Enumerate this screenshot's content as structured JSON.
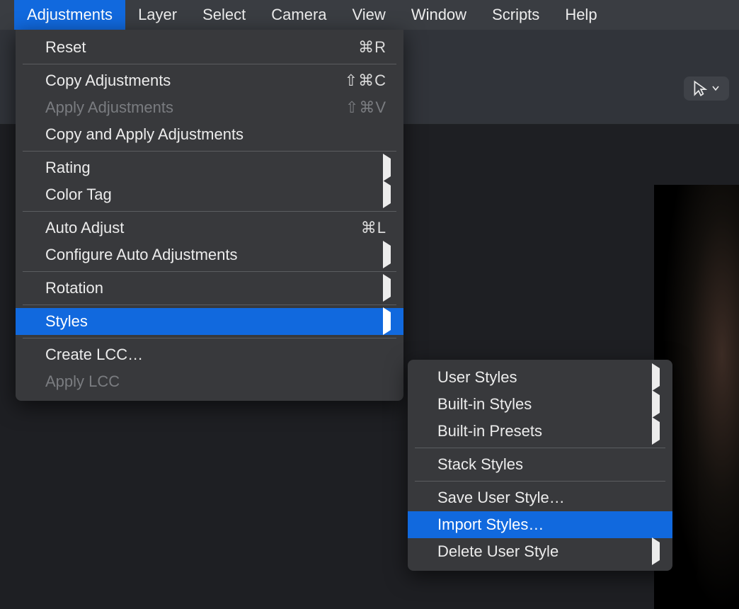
{
  "menubar": {
    "items": [
      {
        "label": "Adjustments",
        "active": true
      },
      {
        "label": "Layer"
      },
      {
        "label": "Select"
      },
      {
        "label": "Camera"
      },
      {
        "label": "View"
      },
      {
        "label": "Window"
      },
      {
        "label": "Scripts"
      },
      {
        "label": "Help"
      }
    ]
  },
  "menu": {
    "groups": [
      [
        {
          "label": "Reset",
          "shortcut": "⌘R"
        }
      ],
      [
        {
          "label": "Copy Adjustments",
          "shortcut": "⇧⌘C"
        },
        {
          "label": "Apply Adjustments",
          "shortcut": "⇧⌘V",
          "disabled": true
        },
        {
          "label": "Copy and Apply Adjustments"
        }
      ],
      [
        {
          "label": "Rating",
          "submenu": true
        },
        {
          "label": "Color Tag",
          "submenu": true
        }
      ],
      [
        {
          "label": "Auto Adjust",
          "shortcut": "⌘L"
        },
        {
          "label": "Configure Auto Adjustments",
          "submenu": true
        }
      ],
      [
        {
          "label": "Rotation",
          "submenu": true
        }
      ],
      [
        {
          "label": "Styles",
          "submenu": true,
          "highlight": true
        }
      ],
      [
        {
          "label": "Create LCC…"
        },
        {
          "label": "Apply LCC",
          "disabled": true
        }
      ]
    ]
  },
  "submenu": {
    "groups": [
      [
        {
          "label": "User Styles",
          "submenu": true
        },
        {
          "label": "Built-in Styles",
          "submenu": true
        },
        {
          "label": "Built-in Presets",
          "submenu": true
        }
      ],
      [
        {
          "label": "Stack Styles"
        }
      ],
      [
        {
          "label": "Save User Style…"
        },
        {
          "label": "Import Styles…",
          "highlight": true
        },
        {
          "label": "Delete User Style",
          "submenu": true
        }
      ]
    ]
  }
}
